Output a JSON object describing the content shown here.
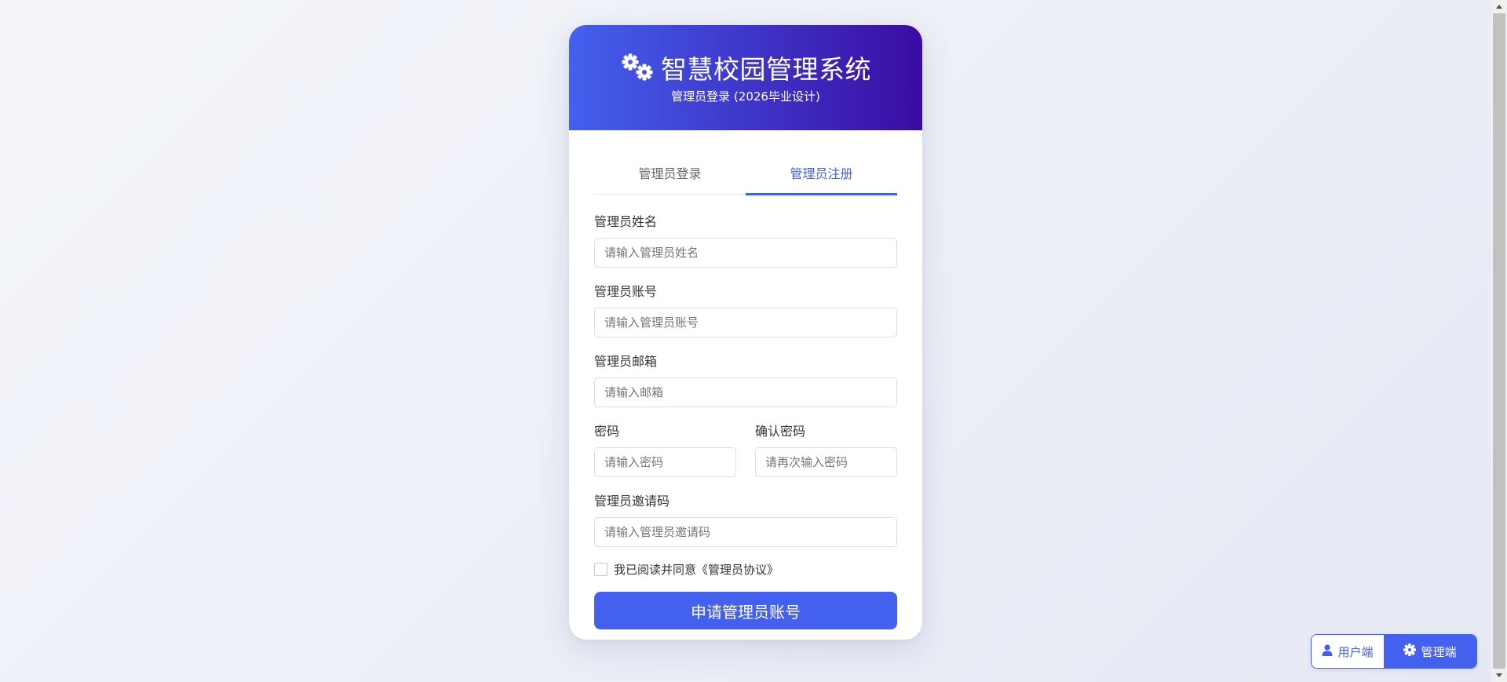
{
  "header": {
    "title": "智慧校园管理系统",
    "subtitle": "管理员登录 (2026毕业设计)",
    "gradient_start": "#4361ee",
    "gradient_end": "#3a0ca3",
    "icon": "gears-icon"
  },
  "tabs": [
    {
      "label": "管理员登录",
      "active": false
    },
    {
      "label": "管理员注册",
      "active": true
    }
  ],
  "form": {
    "name_label": "管理员姓名",
    "name_placeholder": "请输入管理员姓名",
    "account_label": "管理员账号",
    "account_placeholder": "请输入管理员账号",
    "email_label": "管理员邮箱",
    "email_placeholder": "请输入邮箱",
    "password_label": "密码",
    "password_placeholder": "请输入密码",
    "confirm_label": "确认密码",
    "confirm_placeholder": "请再次输入密码",
    "invite_label": "管理员邀请码",
    "invite_placeholder": "请输入管理员邀请码",
    "agree_text": "我已阅读并同意《管理员协议》",
    "agree_checked": false,
    "submit_label": "申请管理员账号"
  },
  "switcher": {
    "user_label": "用户端",
    "user_icon": "user-icon",
    "admin_label": "管理端",
    "admin_icon": "gear-icon",
    "active": "admin"
  },
  "colors": {
    "accent": "#4361ee",
    "text": "#333333"
  }
}
